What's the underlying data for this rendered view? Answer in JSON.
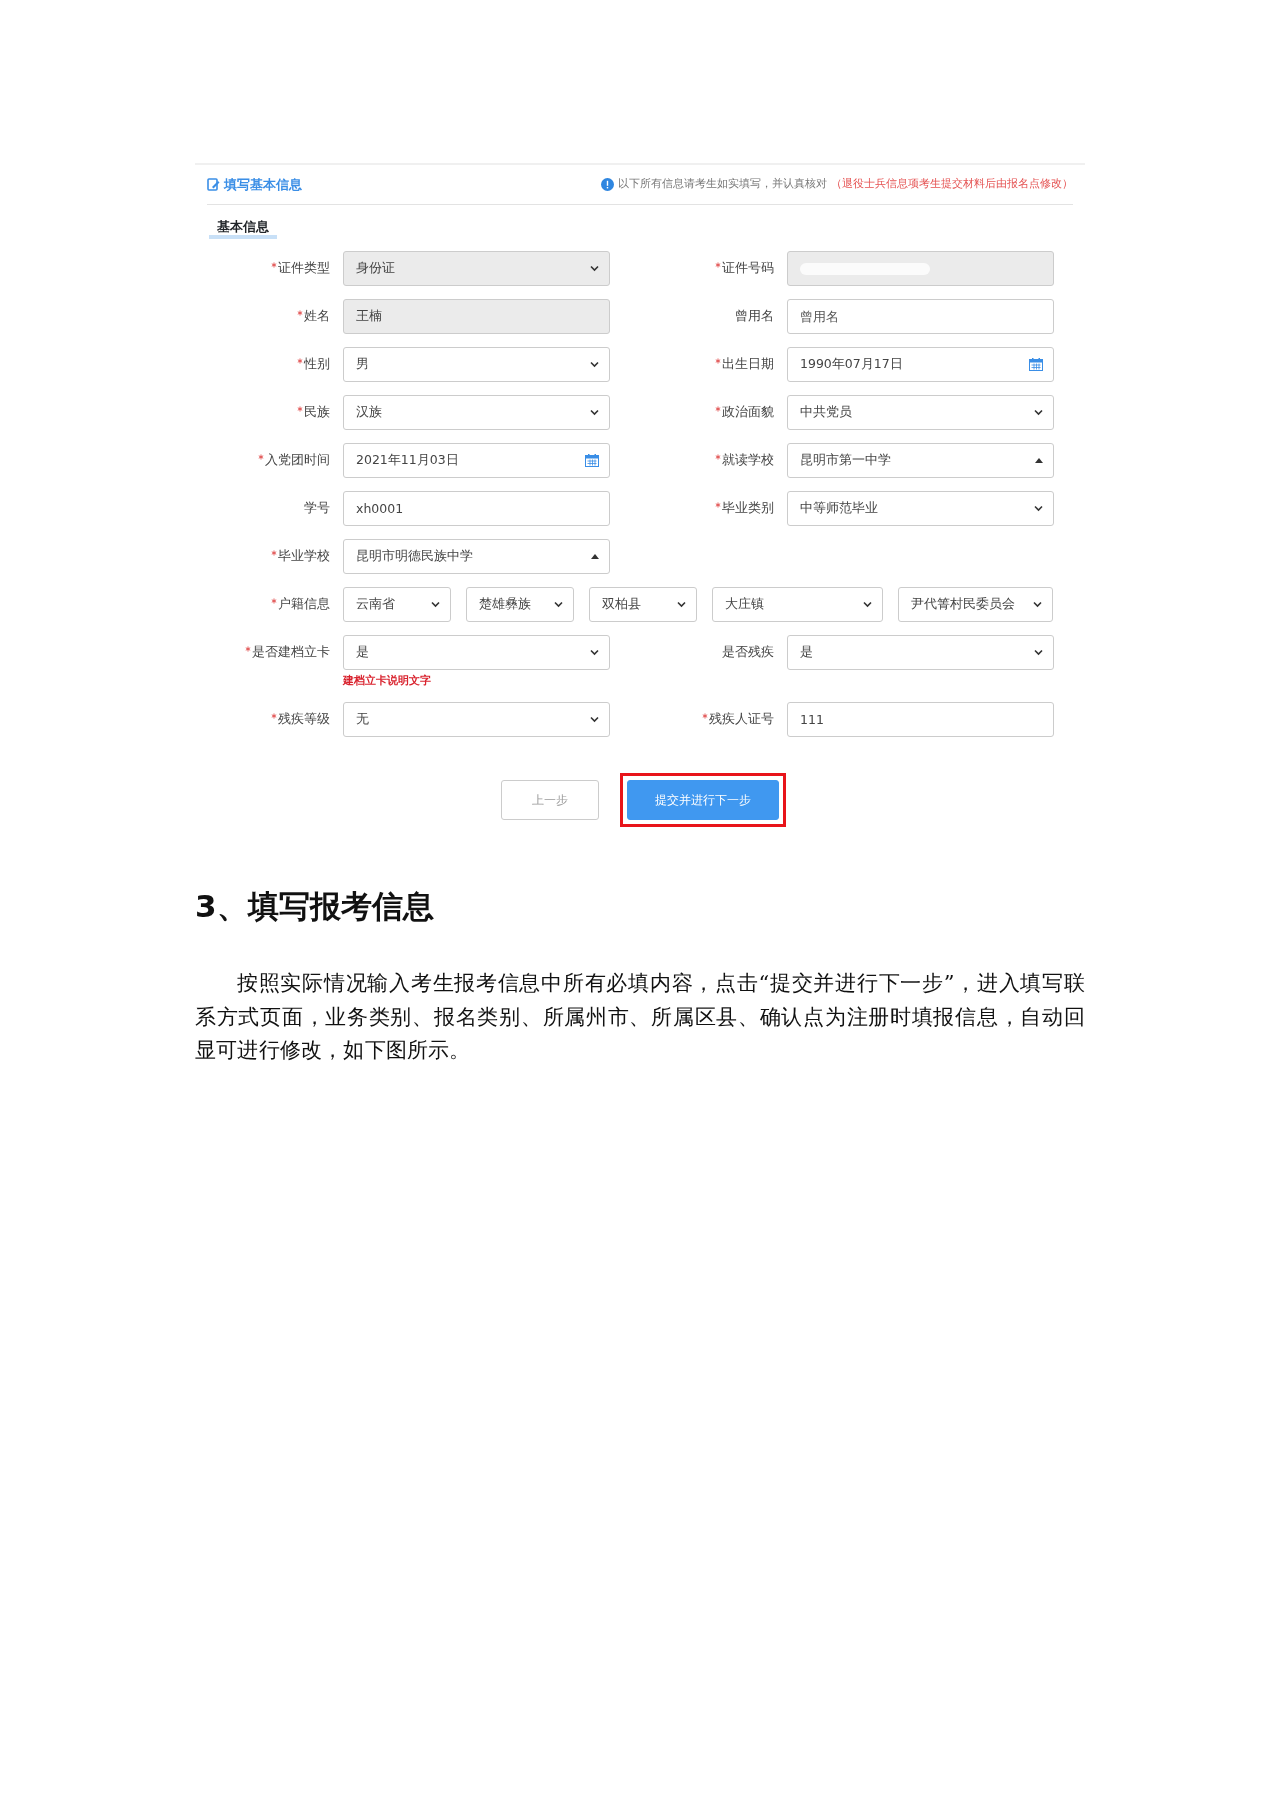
{
  "panel": {
    "title": "填写基本信息",
    "notice": "以下所有信息请考生如实填写，并认真核对",
    "notice_warning": "（退役士兵信息项考生提交材料后由报名点修改）",
    "section": "基本信息",
    "rows": [
      {
        "kind": "pair",
        "cells": [
          {
            "label": "证件类型",
            "required": true,
            "kind": "select",
            "value": "身份证",
            "disabled": true
          },
          {
            "label": "证件号码",
            "required": true,
            "kind": "text",
            "disabled": true,
            "redacted": true
          }
        ]
      },
      {
        "kind": "pair",
        "cells": [
          {
            "label": "姓名",
            "required": true,
            "kind": "text",
            "value": "王楠",
            "disabled": true
          },
          {
            "label": "曾用名",
            "required": false,
            "kind": "text",
            "placeholder": "曾用名",
            "disabled": false
          }
        ]
      },
      {
        "kind": "pair",
        "cells": [
          {
            "label": "性别",
            "required": true,
            "kind": "select",
            "value": "男",
            "disabled": false
          },
          {
            "label": "出生日期",
            "required": true,
            "kind": "date",
            "value": "1990年07月17日",
            "disabled": false
          }
        ]
      },
      {
        "kind": "pair",
        "cells": [
          {
            "label": "民族",
            "required": true,
            "kind": "select",
            "value": "汉族",
            "disabled": false
          },
          {
            "label": "政治面貌",
            "required": true,
            "kind": "select",
            "value": "中共党员",
            "disabled": false
          }
        ]
      },
      {
        "kind": "pair",
        "cells": [
          {
            "label": "入党团时间",
            "required": true,
            "kind": "date",
            "value": "2021年11月03日",
            "disabled": false
          },
          {
            "label": "就读学校",
            "required": true,
            "kind": "combo",
            "value": "昆明市第一中学",
            "disabled": false
          }
        ]
      },
      {
        "kind": "pair",
        "cells": [
          {
            "label": "学号",
            "required": false,
            "kind": "text",
            "value": "xh0001",
            "disabled": false
          },
          {
            "label": "毕业类别",
            "required": true,
            "kind": "select",
            "value": "中等师范毕业",
            "disabled": false
          }
        ]
      },
      {
        "kind": "pair",
        "cells": [
          {
            "label": "毕业学校",
            "required": true,
            "kind": "combo",
            "value": "昆明市明德民族中学",
            "disabled": false
          }
        ]
      },
      {
        "kind": "multi",
        "label": "户籍信息",
        "required": true,
        "selects": [
          "云南省",
          "楚雄彝族",
          "双柏县",
          "大庄镇",
          "尹代箐村民委员会"
        ]
      },
      {
        "kind": "pair",
        "cells": [
          {
            "label": "是否建档立卡",
            "required": true,
            "kind": "select",
            "value": "是",
            "disabled": false,
            "hint": "建档立卡说明文字"
          },
          {
            "label": "是否残疾",
            "required": false,
            "kind": "select",
            "value": "是",
            "disabled": false
          }
        ]
      },
      {
        "kind": "pair",
        "cells": [
          {
            "label": "残疾等级",
            "required": true,
            "kind": "select",
            "value": "无",
            "disabled": false
          },
          {
            "label": "残疾人证号",
            "required": true,
            "kind": "text",
            "value": "111",
            "disabled": false
          }
        ]
      }
    ],
    "buttons": [
      {
        "label": "上一步",
        "kind": "secondary",
        "highlighted": false
      },
      {
        "label": "提交并进行下一步",
        "kind": "primary",
        "highlighted": true
      }
    ]
  },
  "document": {
    "heading": "3、填写报考信息",
    "paragraph": "按照实际情况输入考生报考信息中所有必填内容，点击“提交并进行下一步”，进入填写联系方式页面，业务类别、报名类别、所属州市、所属区县、确认点为注册时填报信息，自动回显可进行修改，如下图所示。"
  }
}
